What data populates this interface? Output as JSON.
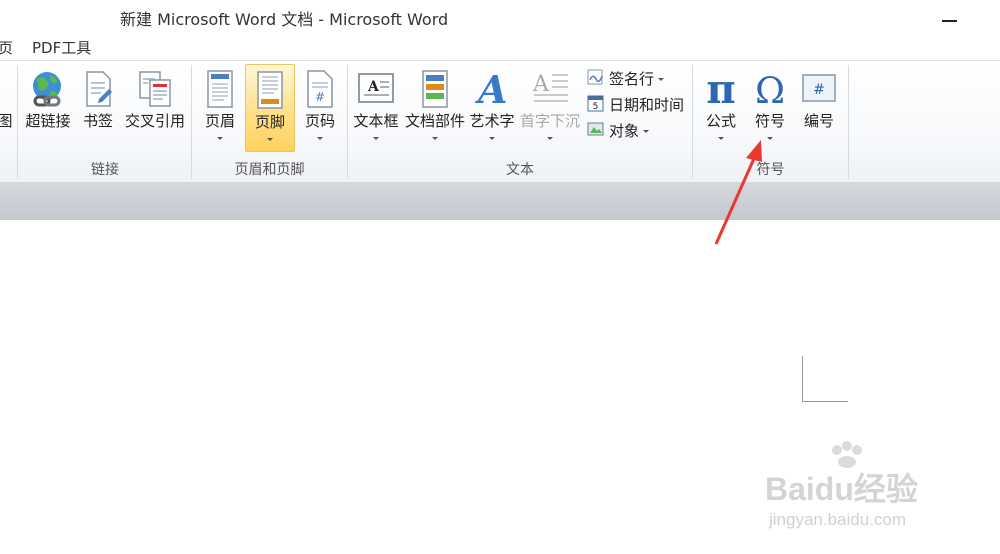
{
  "window": {
    "title": "新建 Microsoft Word 文档 - Microsoft Word"
  },
  "menu": {
    "items": [
      {
        "label": "页"
      },
      {
        "label": "PDF工具"
      }
    ]
  },
  "ribbon": {
    "groups": {
      "links": {
        "label": "链接",
        "buttons": [
          {
            "label": "超链接"
          },
          {
            "label": "书签"
          },
          {
            "label": "交叉引用"
          }
        ]
      },
      "header_footer": {
        "label": "页眉和页脚",
        "buttons": [
          {
            "label": "页眉"
          },
          {
            "label": "页脚"
          },
          {
            "label": "页码"
          }
        ]
      },
      "text": {
        "label": "文本",
        "buttons": [
          {
            "label": "文本框"
          },
          {
            "label": "文档部件"
          },
          {
            "label": "艺术字"
          },
          {
            "label": "首字下沉"
          }
        ],
        "small_buttons": [
          {
            "label": "签名行"
          },
          {
            "label": "日期和时间"
          },
          {
            "label": "对象"
          }
        ]
      },
      "symbols": {
        "label": "符号",
        "buttons": [
          {
            "label": "公式"
          },
          {
            "label": "符号"
          },
          {
            "label": "编号"
          }
        ]
      }
    },
    "partial_left_label": "图"
  },
  "icons": {
    "hyperlink": "globe-chain-icon",
    "bookmark": "bookmark-page-icon",
    "cross_reference": "cross-reference-icon",
    "header": "header-page-icon",
    "footer": "footer-page-icon",
    "page_number": "page-number-icon",
    "textbox": "textbox-icon",
    "quick_parts": "quick-parts-icon",
    "wordart": "wordart-icon",
    "dropcap": "dropcap-icon",
    "signature": "signature-line-icon",
    "datetime": "calendar-icon",
    "object": "object-icon",
    "equation": "pi-icon",
    "symbol": "omega-icon",
    "numbering": "numbering-icon"
  },
  "colors": {
    "active_button": "#ffd25c",
    "annotation_arrow": "#e8392f",
    "ribbon_border": "#b9c3cf"
  },
  "watermark": {
    "brand": "Baidu经验",
    "url": "jingyan.baidu.com"
  }
}
